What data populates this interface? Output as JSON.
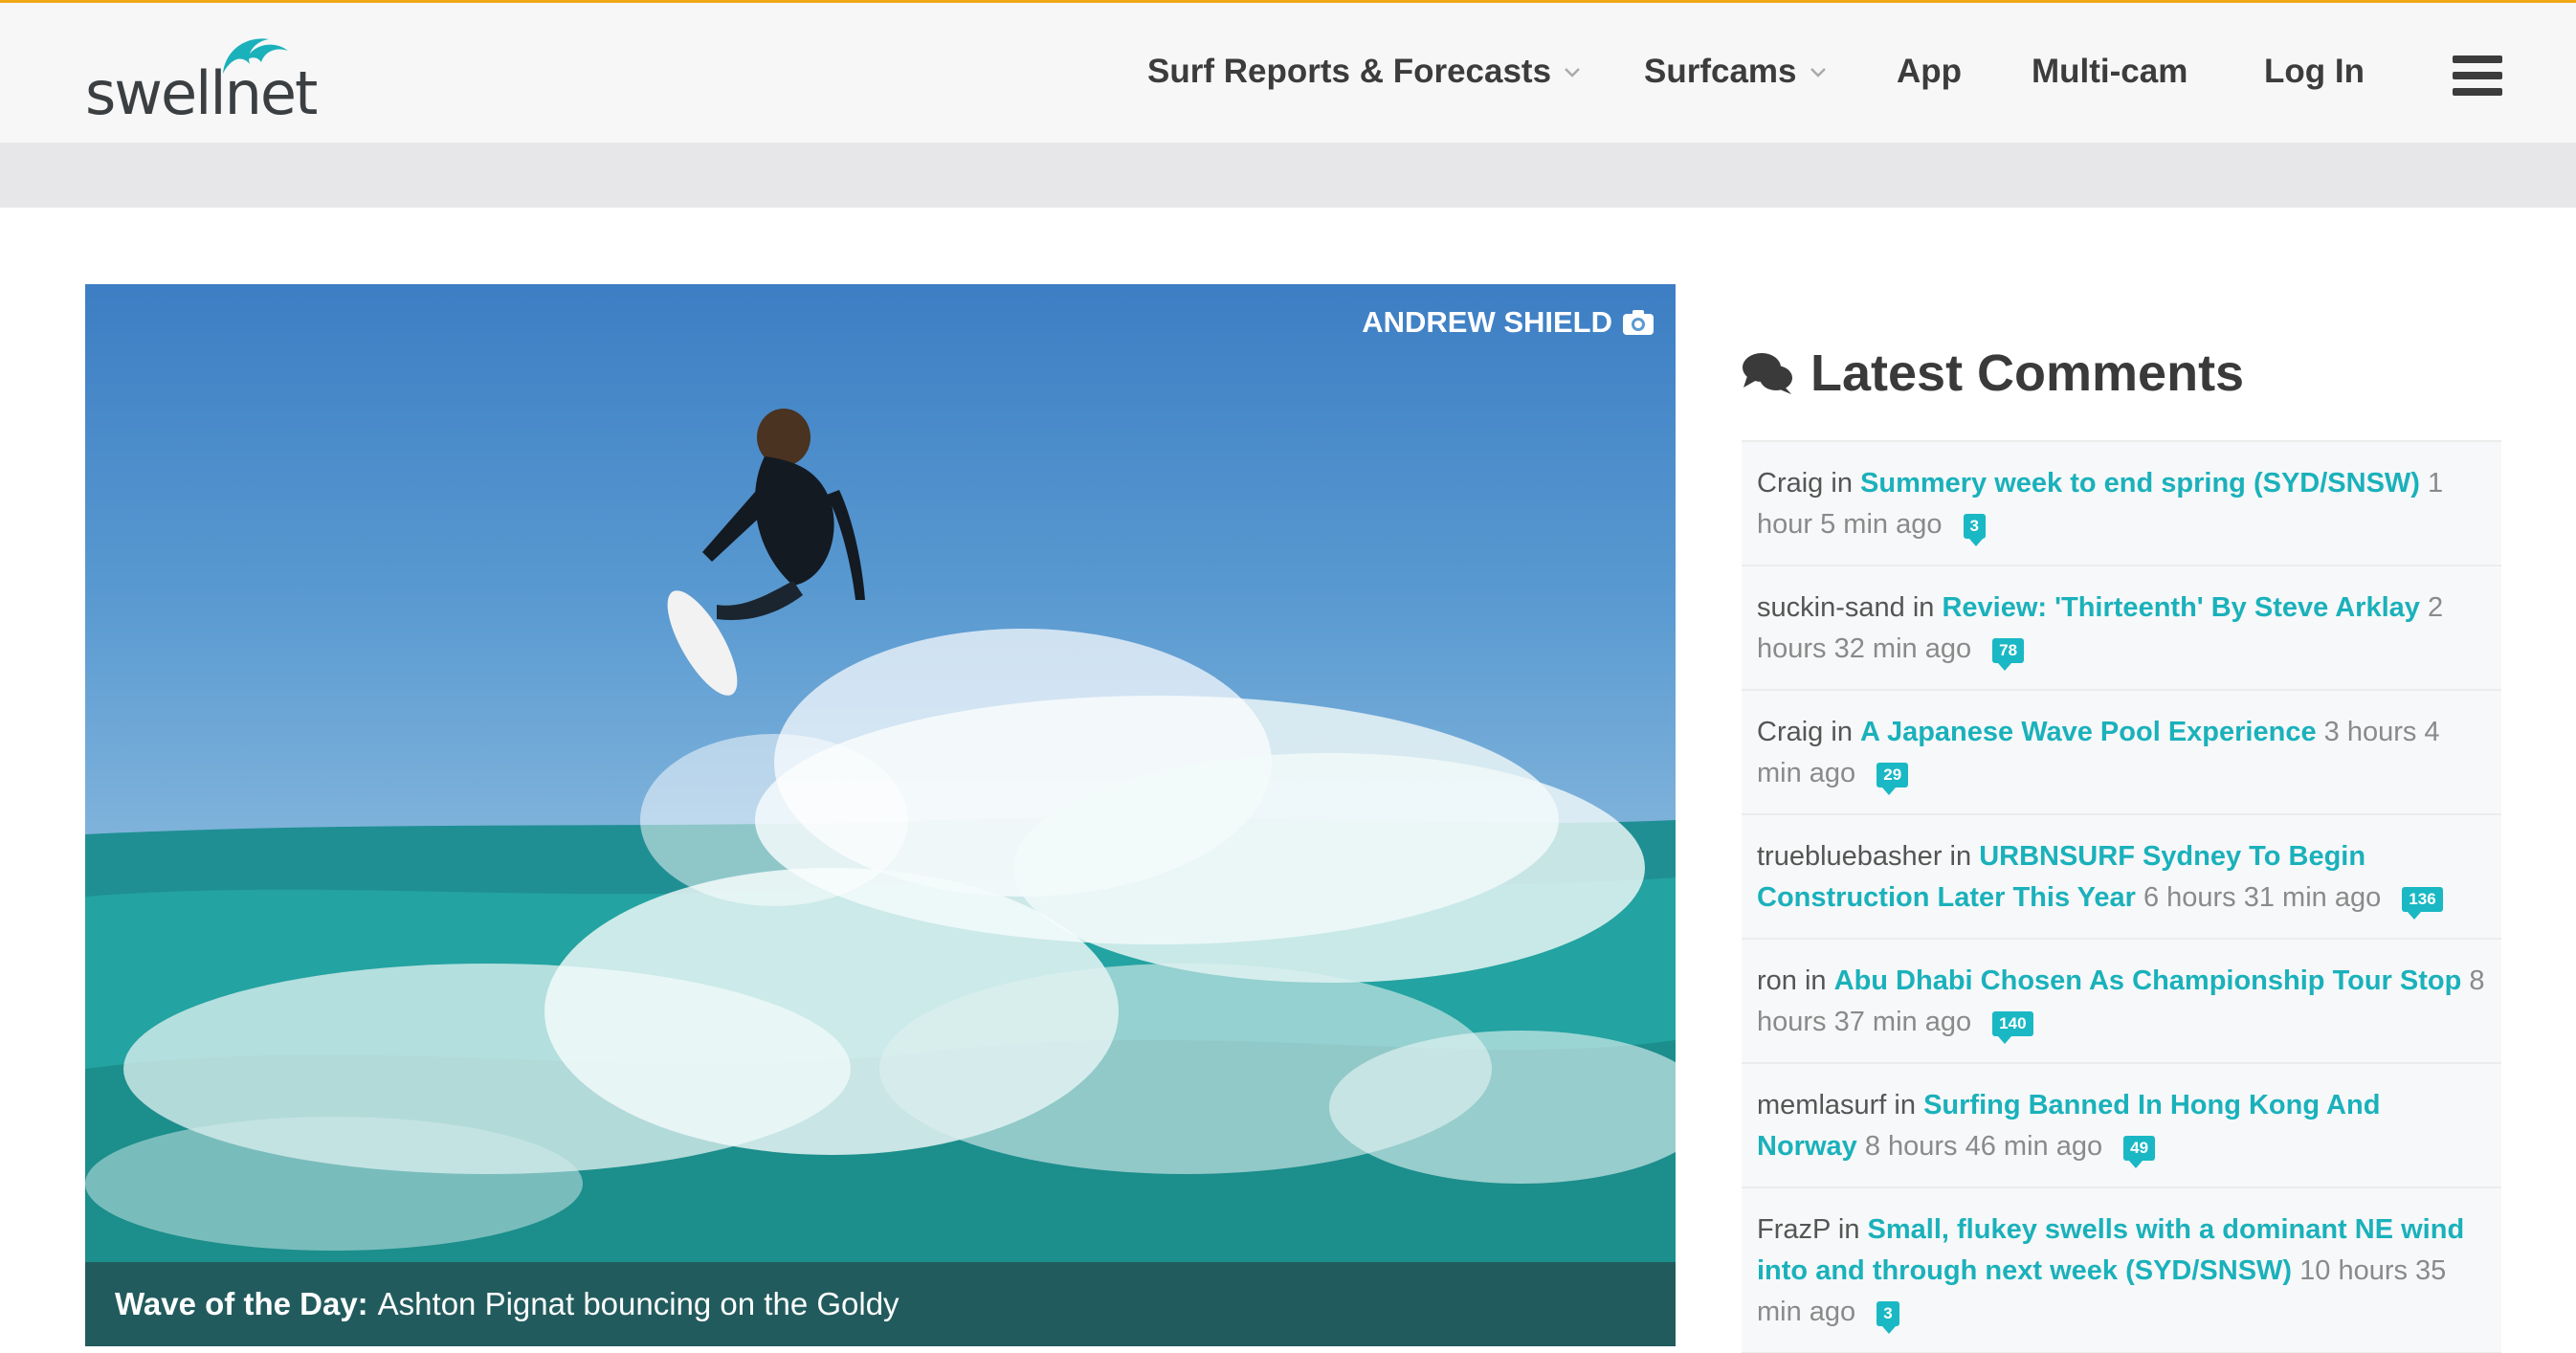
{
  "header": {
    "logo_text": "swellnet",
    "nav": [
      {
        "label": "Surf Reports & Forecasts",
        "has_dropdown": true
      },
      {
        "label": "Surfcams",
        "has_dropdown": true
      },
      {
        "label": "App",
        "has_dropdown": false
      },
      {
        "label": "Multi-cam",
        "has_dropdown": false
      },
      {
        "label": "Log In",
        "has_dropdown": false
      }
    ],
    "menu_icon": "hamburger-icon",
    "accent_color": "#f0a817"
  },
  "hero": {
    "photo_credit": "ANDREW SHIELD",
    "credit_icon": "camera-icon",
    "caption_label": "Wave of the Day:",
    "caption_text": "Ashton Pignat bouncing on the Goldy"
  },
  "comments": {
    "title": "Latest Comments",
    "title_icon": "comments-icon",
    "link_color": "#1ab1bb",
    "items": [
      {
        "user": "Craig",
        "in": "in",
        "title": "Summery week to end spring (SYD/SNSW)",
        "time": "1 hour 5 min ago",
        "count": "3"
      },
      {
        "user": "suckin-sand",
        "in": "in",
        "title": "Review: 'Thirteenth' By Steve Arklay",
        "time": "2 hours 32 min ago",
        "count": "78"
      },
      {
        "user": "Craig",
        "in": "in",
        "title": "A Japanese Wave Pool Experience",
        "time": "3 hours 4 min ago",
        "count": "29"
      },
      {
        "user": "truebluebasher",
        "in": "in",
        "title": "URBNSURF Sydney To Begin Construction Later This Year",
        "time": "6 hours 31 min ago",
        "count": "136"
      },
      {
        "user": "ron",
        "in": "in",
        "title": "Abu Dhabi Chosen As Championship Tour Stop",
        "time": "8 hours 37 min ago",
        "count": "140"
      },
      {
        "user": "memlasurf",
        "in": "in",
        "title": "Surfing Banned In Hong Kong And Norway",
        "time": "8 hours 46 min ago",
        "count": "49"
      },
      {
        "user": "FrazP",
        "in": "in",
        "title": "Small, flukey swells with a dominant NE wind into and through next week (SYD/SNSW)",
        "time": "10 hours 35 min ago",
        "count": "3"
      }
    ]
  }
}
